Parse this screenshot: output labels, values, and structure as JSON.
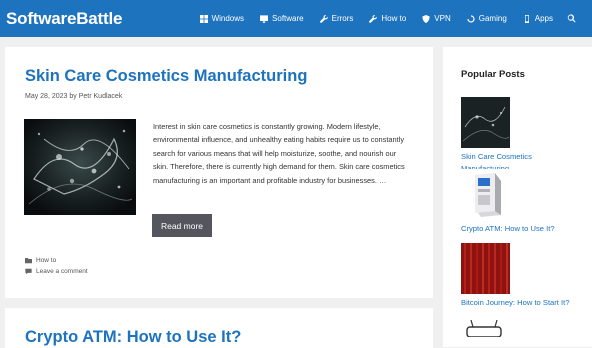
{
  "header": {
    "brand": "SoftwareBattle",
    "nav": [
      {
        "label": "Windows",
        "icon": "windows-icon"
      },
      {
        "label": "Software",
        "icon": "monitor-icon"
      },
      {
        "label": "Errors",
        "icon": "wrench-icon"
      },
      {
        "label": "How to",
        "icon": "wrench-icon"
      },
      {
        "label": "VPN",
        "icon": "shield-icon"
      },
      {
        "label": "Gaming",
        "icon": "spinner-icon"
      },
      {
        "label": "Apps",
        "icon": "phone-icon"
      }
    ],
    "search_icon": "search-icon"
  },
  "post": {
    "title": "Skin Care Cosmetics Manufacturing",
    "date": "May 28, 2023",
    "by": "by",
    "author": "Petr Kudlacek",
    "excerpt": "Interest in skin care cosmetics is constantly growing. Modern lifestyle, environmental influence, and unhealthy eating habits require us to constantly search for various means that will help moisturize, soothe, and nourish our skin. Therefore, there is currently high demand for them.     Skin care cosmetics manufacturing is an important and profitable industry for businesses. …",
    "read_more": "Read more",
    "category": "How to",
    "comment": "Leave a comment"
  },
  "next_post": {
    "title": "Crypto ATM: How to Use It?"
  },
  "sidebar": {
    "widget_title": "Popular Posts",
    "posts": [
      {
        "title": "Skin Care Cosmetics Manufacturing"
      },
      {
        "title": "Crypto ATM: How to Use It?"
      },
      {
        "title": "Bitcoin Journey: How to Start It?"
      }
    ]
  },
  "colors": {
    "header_bg": "#1e73be",
    "link": "#1e73be",
    "button_bg": "#55555e"
  }
}
